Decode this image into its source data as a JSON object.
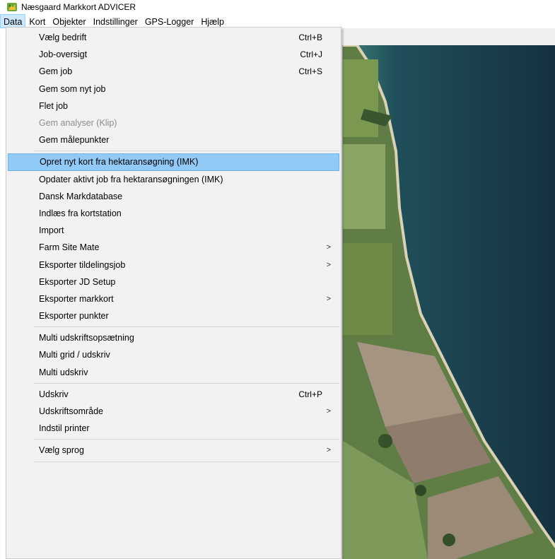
{
  "window": {
    "title": "Næsgaard Markkort ADVICER",
    "icon": "app-leaf-icon"
  },
  "menubar": {
    "items": [
      {
        "label": "Data",
        "active": true
      },
      {
        "label": "Kort"
      },
      {
        "label": "Objekter"
      },
      {
        "label": "Indstillinger"
      },
      {
        "label": "GPS-Logger"
      },
      {
        "label": "Hjælp"
      }
    ]
  },
  "data_menu": {
    "items": [
      {
        "label": "Vælg bedrift",
        "shortcut": "Ctrl+B"
      },
      {
        "label": "Job-oversigt",
        "shortcut": "Ctrl+J"
      },
      {
        "label": "Gem job",
        "shortcut": "Ctrl+S"
      },
      {
        "label": "Gem som nyt job"
      },
      {
        "label": "Flet job"
      },
      {
        "label": "Gem analyser (Klip)",
        "disabled": true
      },
      {
        "label": "Gem målepunkter"
      },
      {
        "label": "Opret nyt kort fra hektaransøgning (IMK)",
        "highlighted": true
      },
      {
        "label": "Opdater aktivt job fra hektaransøgningen (IMK)"
      },
      {
        "label": "Dansk Markdatabase"
      },
      {
        "label": "Indlæs fra kortstation"
      },
      {
        "label": "Import"
      },
      {
        "label": "Farm Site Mate",
        "submenu": true
      },
      {
        "label": "Eksporter tildelingsjob",
        "submenu": true
      },
      {
        "label": "Eksporter JD Setup"
      },
      {
        "label": "Eksporter markkort",
        "submenu": true
      },
      {
        "label": "Eksporter punkter"
      },
      {
        "label": "Multi udskriftsopsætning"
      },
      {
        "label": "Multi grid / udskriv"
      },
      {
        "label": "Multi udskriv"
      },
      {
        "label": "Udskriv",
        "shortcut": "Ctrl+P"
      },
      {
        "label": "Udskriftsområde",
        "submenu": true
      },
      {
        "label": "Indstil printer"
      },
      {
        "label": "Vælg sprog",
        "submenu": true
      }
    ],
    "submenu_glyph": ">"
  },
  "colors": {
    "menubar_active_bg": "#cce8ff",
    "menu_highlight_bg": "#91c9f7",
    "menu_bg": "#f2f2f2",
    "sea": "#1d3f4d",
    "farmland": "#6f8a4a"
  }
}
